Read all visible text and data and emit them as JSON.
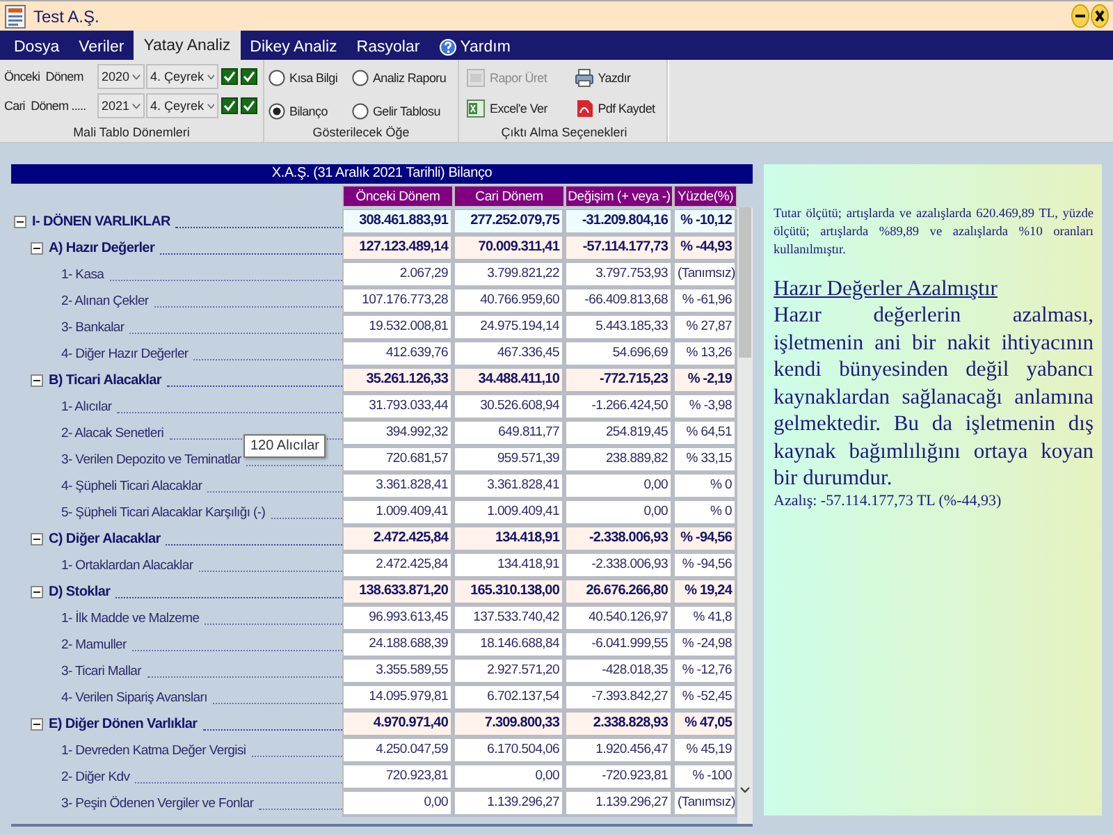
{
  "window": {
    "title": "Test A.Ş."
  },
  "menu": [
    {
      "label": "Dosya",
      "selected": false,
      "kind": "plain"
    },
    {
      "label": "Veriler",
      "selected": false,
      "kind": "plain"
    },
    {
      "label": "Yatay Analiz",
      "selected": true,
      "kind": "plain"
    },
    {
      "label": "Dikey Analiz",
      "selected": false,
      "kind": "plain"
    },
    {
      "label": "Rasyolar",
      "selected": false,
      "kind": "plain"
    },
    {
      "label": "Yardım",
      "selected": false,
      "kind": "help"
    }
  ],
  "periods": {
    "title": "Mali Tablo Dönemleri",
    "rows": [
      {
        "label": "Önceki  Dönem",
        "year": "2020",
        "quarter": "4. Çeyrek",
        "checks": [
          {
            "checked": true
          },
          {
            "checked": true
          }
        ]
      },
      {
        "label": "Cari  Dönem .....",
        "year": "2021",
        "quarter": "4. Çeyrek",
        "checks": [
          {
            "checked": true
          },
          {
            "checked": true
          }
        ]
      }
    ]
  },
  "display": {
    "title": "Gösterilecek Öğe",
    "options": [
      {
        "label": "Kısa Bilgi",
        "selected": false
      },
      {
        "label": "Analiz Raporu",
        "selected": false
      },
      {
        "label": "Bilanço",
        "selected": true
      },
      {
        "label": "Gelir Tablosu",
        "selected": false
      }
    ]
  },
  "output": {
    "title": "Çıktı Alma Seçenekleri",
    "actions": [
      {
        "label": "Rapor Üret",
        "kind": "report",
        "disabled": true
      },
      {
        "label": "Yazdır",
        "kind": "print",
        "disabled": false
      },
      {
        "label": "Excel'e Ver",
        "kind": "excel",
        "disabled": false
      },
      {
        "label": "Pdf Kaydet",
        "kind": "pdf",
        "disabled": false
      }
    ]
  },
  "table": {
    "title": "X.A.Ş. (31 Aralık 2021 Tarihli) Bilanço",
    "columns": [
      "Önceki Dönem",
      "Cari Dönem",
      "Değişim (+ veya -)",
      "Yüzde(%)"
    ],
    "tooltip": "120 Alıcılar",
    "rows": [
      {
        "label": "I- DÖNEN VARLIKLAR",
        "values": [
          "308.461.883,91",
          "277.252.079,75",
          "-31.209.804,16",
          "% -10,12"
        ],
        "expanded": true,
        "children": [
          {
            "label": "A) Hazır Değerler",
            "values": [
              "127.123.489,14",
              "70.009.311,41",
              "-57.114.177,73",
              "% -44,93"
            ],
            "expanded": true,
            "children": [
              {
                "label": "1- Kasa",
                "values": [
                  "2.067,29",
                  "3.799.821,22",
                  "3.797.753,93",
                  "(Tanımsız)"
                ]
              },
              {
                "label": "2- Alınan Çekler",
                "values": [
                  "107.176.773,28",
                  "40.766.959,60",
                  "-66.409.813,68",
                  "% -61,96"
                ]
              },
              {
                "label": "3- Bankalar",
                "values": [
                  "19.532.008,81",
                  "24.975.194,14",
                  "5.443.185,33",
                  "% 27,87"
                ]
              },
              {
                "label": "4- Diğer Hazır Değerler",
                "values": [
                  "412.639,76",
                  "467.336,45",
                  "54.696,69",
                  "% 13,26"
                ]
              }
            ]
          },
          {
            "label": "B) Ticari Alacaklar",
            "values": [
              "35.261.126,33",
              "34.488.411,10",
              "-772.715,23",
              "% -2,19"
            ],
            "expanded": true,
            "children": [
              {
                "label": "1- Alıcılar",
                "values": [
                  "31.793.033,44",
                  "30.526.608,94",
                  "-1.266.424,50",
                  "% -3,98"
                ]
              },
              {
                "label": "2- Alacak Senetleri",
                "values": [
                  "394.992,32",
                  "649.811,77",
                  "254.819,45",
                  "% 64,51"
                ]
              },
              {
                "label": "3- Verilen Depozito ve Teminatlar",
                "values": [
                  "720.681,57",
                  "959.571,39",
                  "238.889,82",
                  "% 33,15"
                ]
              },
              {
                "label": "4- Şüpheli Ticari Alacaklar",
                "values": [
                  "3.361.828,41",
                  "3.361.828,41",
                  "0,00",
                  "% 0"
                ]
              },
              {
                "label": "5- Şüpheli Ticari Alacaklar Karşılığı (-)",
                "values": [
                  "1.009.409,41",
                  "1.009.409,41",
                  "0,00",
                  "% 0"
                ]
              }
            ]
          },
          {
            "label": "C) Diğer Alacaklar",
            "values": [
              "2.472.425,84",
              "134.418,91",
              "-2.338.006,93",
              "% -94,56"
            ],
            "expanded": true,
            "children": [
              {
                "label": "1- Ortaklardan Alacaklar",
                "values": [
                  "2.472.425,84",
                  "134.418,91",
                  "-2.338.006,93",
                  "% -94,56"
                ]
              }
            ]
          },
          {
            "label": "D) Stoklar",
            "values": [
              "138.633.871,20",
              "165.310.138,00",
              "26.676.266,80",
              "% 19,24"
            ],
            "expanded": true,
            "children": [
              {
                "label": "1- İlk Madde ve Malzeme",
                "values": [
                  "96.993.613,45",
                  "137.533.740,42",
                  "40.540.126,97",
                  "% 41,8"
                ]
              },
              {
                "label": "2- Mamuller",
                "values": [
                  "24.188.688,39",
                  "18.146.688,84",
                  "-6.041.999,55",
                  "% -24,98"
                ]
              },
              {
                "label": "3- Ticari Mallar",
                "values": [
                  "3.355.589,55",
                  "2.927.571,20",
                  "-428.018,35",
                  "% -12,76"
                ]
              },
              {
                "label": "4- Verilen Sipariş Avansları",
                "values": [
                  "14.095.979,81",
                  "6.702.137,54",
                  "-7.393.842,27",
                  "% -52,45"
                ]
              }
            ]
          },
          {
            "label": "E) Diğer Dönen Varlıklar",
            "values": [
              "4.970.971,40",
              "7.309.800,33",
              "2.338.828,93",
              "% 47,05"
            ],
            "expanded": true,
            "children": [
              {
                "label": "1- Devreden Katma Değer Vergisi",
                "values": [
                  "4.250.047,59",
                  "6.170.504,06",
                  "1.920.456,47",
                  "% 45,19"
                ]
              },
              {
                "label": "2- Diğer Kdv",
                "values": [
                  "720.923,81",
                  "0,00",
                  "-720.923,81",
                  "% -100"
                ]
              },
              {
                "label": "3- Peşin Ödenen Vergiler ve Fonlar",
                "values": [
                  "0,00",
                  "1.139.296,27",
                  "1.139.296,27",
                  "(Tanımsız)"
                ]
              }
            ]
          }
        ]
      }
    ]
  },
  "analysis": {
    "note": "Tutar ölçütü; artışlarda ve azalışlarda 620.469,89 TL, yüzde ölçütü; artışlarda %89,89 ve azalışlarda %10 oranları kullanılmıştır.",
    "heading": "Hazır Değerler Azalmıştır",
    "body": "Hazır değerlerin azalması, işletmenin ani bir nakit ihtiyacının kendi bünyesinden değil yabancı kaynaklardan sağlanacağı anlamına gelmektedir. Bu da işletmenin dış kaynak bağımlılığını ortaya koyan bir durumdur.",
    "summary": "Azalış: -57.114.177,73 TL (%-44,93)"
  }
}
